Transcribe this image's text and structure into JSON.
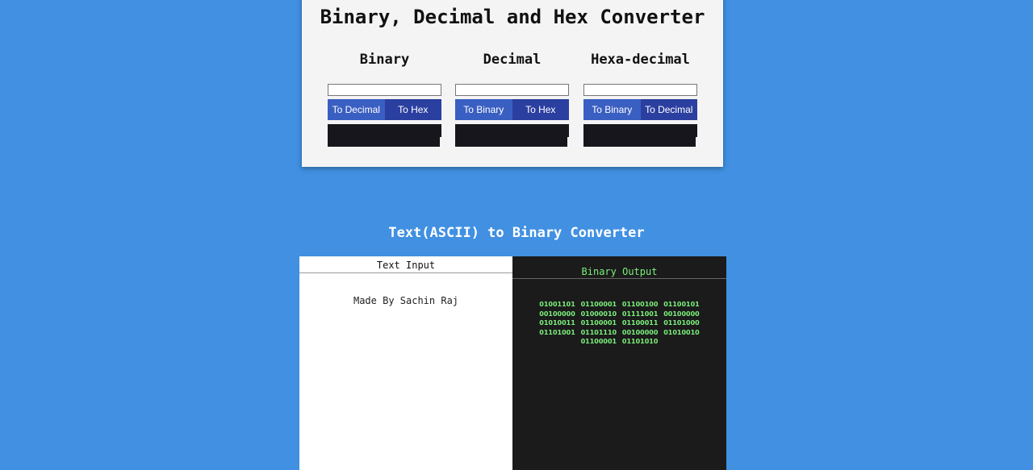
{
  "converter": {
    "title": "Binary, Decimal and Hex Converter",
    "columns": [
      {
        "heading": "Binary",
        "input_value": "",
        "btn_a": "To Decimal",
        "btn_b": "To Hex",
        "output": ""
      },
      {
        "heading": "Decimal",
        "input_value": "",
        "btn_a": "To Binary",
        "btn_b": "To Hex",
        "output": ""
      },
      {
        "heading": "Hexa-decimal",
        "input_value": "",
        "btn_a": "To Binary",
        "btn_b": "To Decimal",
        "output": ""
      }
    ]
  },
  "text_converter": {
    "title": "Text(ASCII) to Binary Converter",
    "input_header": "Text Input",
    "input_value": "Made By Sachin Raj",
    "output_header": "Binary Output",
    "output_value": "01001101 01100001 01100100 01100101 00100000 01000010 01111001 00100000 01010011 01100001 01100011 01101000 01101001 01101110 00100000 01010010 01100001 01101010"
  },
  "colors": {
    "page_background": "#4190e2",
    "card_background": "#f4f4f4",
    "button_primary": "#3a5fc2",
    "button_secondary": "#2b3fa0",
    "output_background": "#16161c",
    "binary_text": "#7cf07c"
  }
}
